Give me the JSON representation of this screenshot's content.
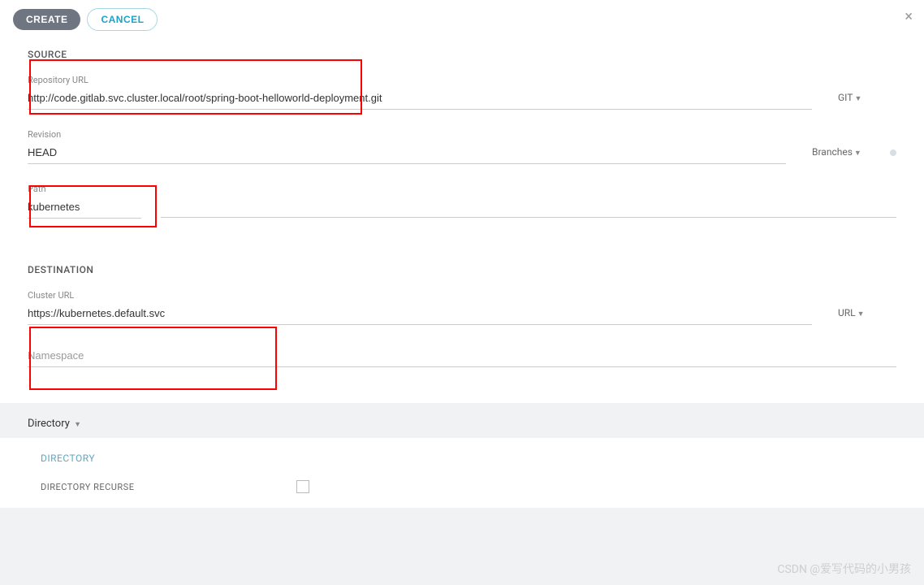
{
  "header": {
    "create_label": "CREATE",
    "cancel_label": "CANCEL"
  },
  "source": {
    "title": "SOURCE",
    "repo_label": "Repository URL",
    "repo_value": "http://code.gitlab.svc.cluster.local/root/spring-boot-helloworld-deployment.git",
    "repo_type": "GIT",
    "revision_label": "Revision",
    "revision_value": "HEAD",
    "revision_type": "Branches",
    "path_label": "Path",
    "path_value": "kubernetes"
  },
  "destination": {
    "title": "DESTINATION",
    "cluster_label": "Cluster URL",
    "cluster_value": "https://kubernetes.default.svc",
    "cluster_type": "URL",
    "namespace_placeholder": "Namespace"
  },
  "directory": {
    "dropdown": "Directory",
    "title": "DIRECTORY",
    "recurse_label": "DIRECTORY RECURSE"
  },
  "watermark": "CSDN @爱写代码的小男孩"
}
